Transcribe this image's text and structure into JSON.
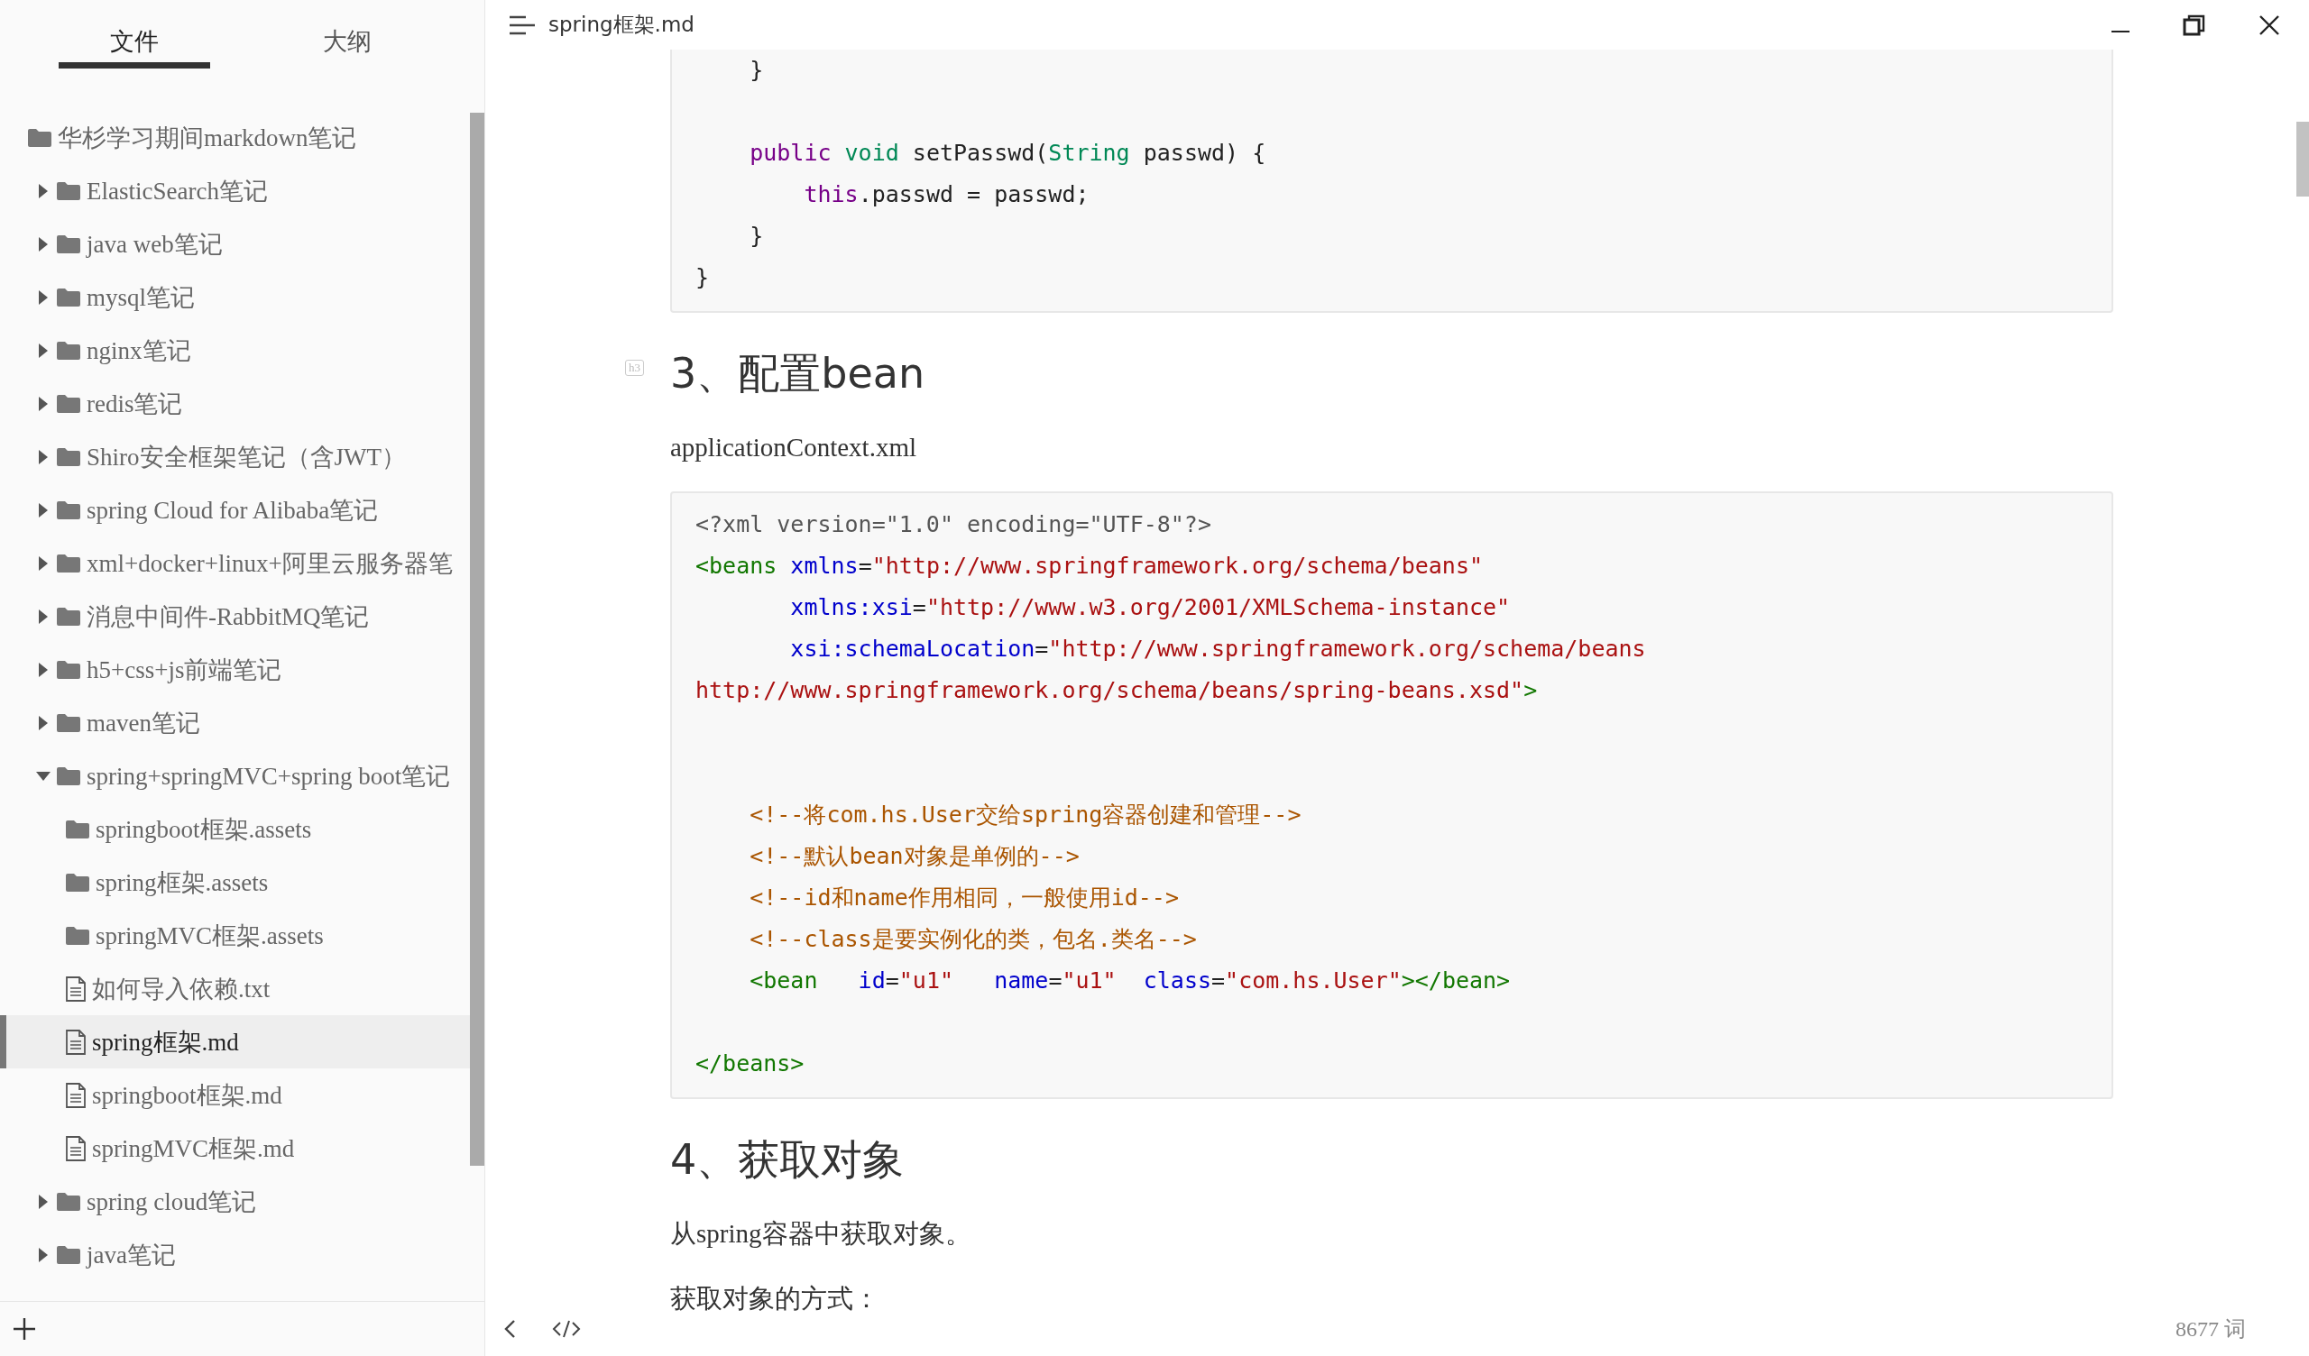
{
  "window": {
    "title": "spring框架.md"
  },
  "sidebar": {
    "tabs": [
      {
        "label": "文件",
        "selected": true
      },
      {
        "label": "大纲",
        "selected": false
      }
    ],
    "tree": [
      {
        "kind": "folder",
        "name": "华杉学习期间markdown笔记",
        "selected": false,
        "children": [
          {
            "kind": "folder",
            "name": "ElasticSearch笔记",
            "expanded": false,
            "selected": false
          },
          {
            "kind": "folder",
            "name": "java web笔记",
            "expanded": false,
            "selected": false
          },
          {
            "kind": "folder",
            "name": "mysql笔记",
            "expanded": false,
            "selected": false
          },
          {
            "kind": "folder",
            "name": "nginx笔记",
            "expanded": false,
            "selected": false
          },
          {
            "kind": "folder",
            "name": "redis笔记",
            "expanded": false,
            "selected": false
          },
          {
            "kind": "folder",
            "name": "Shiro安全框架笔记（含JWT）",
            "expanded": false,
            "selected": false
          },
          {
            "kind": "folder",
            "name": "spring Cloud for Alibaba笔记",
            "expanded": false,
            "selected": false
          },
          {
            "kind": "folder",
            "name": "xml+docker+linux+阿里云服务器笔",
            "expanded": false,
            "selected": false
          },
          {
            "kind": "folder",
            "name": "消息中间件-RabbitMQ笔记",
            "expanded": false,
            "selected": false
          },
          {
            "kind": "folder",
            "name": "h5+css+js前端笔记",
            "expanded": false,
            "selected": false
          },
          {
            "kind": "folder",
            "name": "maven笔记",
            "expanded": false,
            "selected": false
          },
          {
            "kind": "folder",
            "name": "spring+springMVC+spring boot笔记",
            "expanded": true,
            "selected": false,
            "children": [
              {
                "kind": "folder",
                "name": "springboot框架.assets",
                "selected": false
              },
              {
                "kind": "folder",
                "name": "spring框架.assets",
                "selected": false
              },
              {
                "kind": "folder",
                "name": "springMVC框架.assets",
                "selected": false
              },
              {
                "kind": "file",
                "name": "如何导入依赖.txt",
                "selected": false
              },
              {
                "kind": "file",
                "name": "spring框架.md",
                "selected": true
              },
              {
                "kind": "file",
                "name": "springboot框架.md",
                "selected": false
              },
              {
                "kind": "file",
                "name": "springMVC框架.md",
                "selected": false
              }
            ]
          },
          {
            "kind": "folder",
            "name": "spring cloud笔记",
            "expanded": false,
            "selected": false
          },
          {
            "kind": "folder",
            "name": "java笔记",
            "expanded": false,
            "selected": false
          }
        ]
      }
    ]
  },
  "document": [
    {
      "kind": "code",
      "open_top": true,
      "lines": [
        {
          "kind": "code",
          "tokens": [
            {
              "text": "    }",
              "kind": "plain"
            }
          ]
        },
        {
          "kind": "blank"
        },
        {
          "kind": "code",
          "tokens": [
            {
              "text": "    public",
              "kind": "keyword"
            },
            {
              "text": " void",
              "kind": "type"
            },
            {
              "text": " setPasswd(",
              "kind": "plain"
            },
            {
              "text": "String",
              "kind": "type"
            },
            {
              "text": " passwd) {",
              "kind": "plain"
            }
          ]
        },
        {
          "kind": "code",
          "tokens": [
            {
              "text": "        this",
              "kind": "keyword"
            },
            {
              "text": ".passwd = passwd;",
              "kind": "plain"
            }
          ]
        },
        {
          "kind": "code",
          "tokens": [
            {
              "text": "    }",
              "kind": "plain"
            }
          ]
        },
        {
          "kind": "code",
          "tokens": [
            {
              "text": "}",
              "kind": "plain"
            }
          ]
        }
      ]
    },
    {
      "kind": "heading",
      "marker": "h3",
      "text": "3、配置bean"
    },
    {
      "kind": "paragraph",
      "text": "applicationContext.xml"
    },
    {
      "kind": "code",
      "open_top": false,
      "lines": [
        {
          "kind": "code",
          "tokens": [
            {
              "text": "<?xml version=\"1.0\" encoding=\"UTF-8\"?>",
              "kind": "meta"
            }
          ]
        },
        {
          "kind": "code",
          "tokens": [
            {
              "text": "<beans",
              "kind": "tag"
            },
            {
              "text": " xmlns",
              "kind": "attr"
            },
            {
              "text": "=",
              "kind": "plain"
            },
            {
              "text": "\"http://www.springframework.org/schema/beans\"",
              "kind": "string"
            }
          ]
        },
        {
          "kind": "code",
          "tokens": [
            {
              "text": "       xmlns:xsi",
              "kind": "attr"
            },
            {
              "text": "=",
              "kind": "plain"
            },
            {
              "text": "\"http://www.w3.org/2001/XMLSchema-instance\"",
              "kind": "string"
            }
          ]
        },
        {
          "kind": "code",
          "tokens": [
            {
              "text": "       xsi:schemaLocation",
              "kind": "attr"
            },
            {
              "text": "=",
              "kind": "plain"
            },
            {
              "text": "\"http://www.springframework.org/schema/beans",
              "kind": "string"
            }
          ]
        },
        {
          "kind": "code",
          "tokens": [
            {
              "text": "http://www.springframework.org/schema/beans/spring-beans.xsd\"",
              "kind": "string"
            },
            {
              "text": ">",
              "kind": "tag"
            }
          ]
        },
        {
          "kind": "blank"
        },
        {
          "kind": "blank"
        },
        {
          "kind": "code",
          "tokens": [
            {
              "text": "    <!--将com.hs.User交给spring容器创建和管理-->",
              "kind": "comment"
            }
          ]
        },
        {
          "kind": "code",
          "tokens": [
            {
              "text": "    <!--默认bean对象是单例的-->",
              "kind": "comment"
            }
          ]
        },
        {
          "kind": "code",
          "tokens": [
            {
              "text": "    <!--id和name作用相同，一般使用id-->",
              "kind": "comment"
            }
          ]
        },
        {
          "kind": "code",
          "tokens": [
            {
              "text": "    <!--class是要实例化的类，包名.类名-->",
              "kind": "comment"
            }
          ]
        },
        {
          "kind": "code",
          "tokens": [
            {
              "text": "    <bean",
              "kind": "tag"
            },
            {
              "text": "   id",
              "kind": "attr"
            },
            {
              "text": "=",
              "kind": "plain"
            },
            {
              "text": "\"u1\"",
              "kind": "string"
            },
            {
              "text": "   name",
              "kind": "attr"
            },
            {
              "text": "=",
              "kind": "plain"
            },
            {
              "text": "\"u1\"",
              "kind": "string"
            },
            {
              "text": "  class",
              "kind": "attr"
            },
            {
              "text": "=",
              "kind": "plain"
            },
            {
              "text": "\"com.hs.User\"",
              "kind": "string"
            },
            {
              "text": "></bean>",
              "kind": "tag"
            }
          ]
        },
        {
          "kind": "blank"
        },
        {
          "kind": "code",
          "tokens": [
            {
              "text": "</beans>",
              "kind": "tag"
            }
          ]
        }
      ]
    },
    {
      "kind": "heading",
      "text": "4、获取对象"
    },
    {
      "kind": "paragraph",
      "text": "从spring容器中获取对象。"
    },
    {
      "kind": "paragraph",
      "text": "获取对象的方式："
    }
  ],
  "footer": {
    "word_count": "8677 词"
  }
}
